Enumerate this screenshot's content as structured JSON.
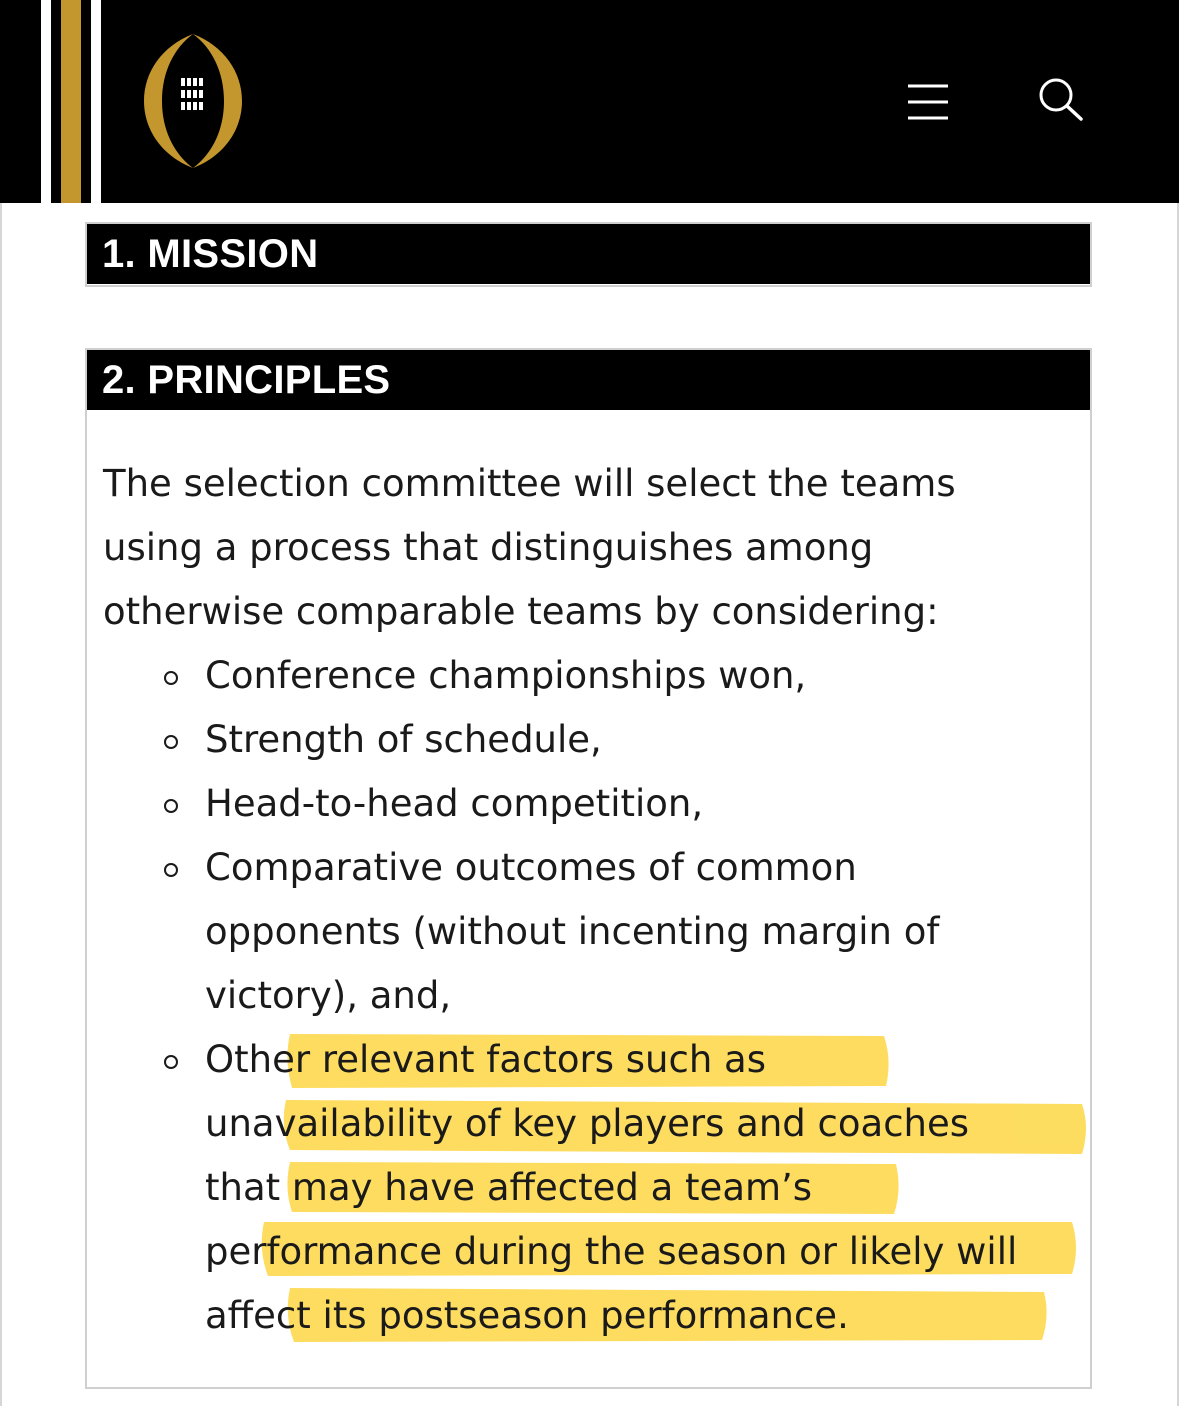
{
  "header": {
    "logo_icon": "cfp-football-logo-icon",
    "menu_icon": "hamburger-menu-icon",
    "search_icon": "search-icon",
    "colors": {
      "background": "#000000",
      "gold": "#c4962e",
      "stripe_white": "#ffffff"
    }
  },
  "sections": [
    {
      "title": "1. MISSION"
    },
    {
      "title": "2. PRINCIPLES",
      "intro": "The selection committee will select the teams using a process that distinguishes among otherwise comparable teams by considering:",
      "criteria": [
        "Conference championships won,",
        "Strength of schedule,",
        "Head-to-head competition,",
        "Comparative outcomes of common opponents (without incenting margin of victory), and,",
        "Other relevant factors such as unavailability of key players and coaches that may have affected a team’s performance during the season or likely will affect its postseason performance."
      ],
      "highlighted_criterion_index": 4,
      "highlight_color": "#fdd94f"
    }
  ]
}
